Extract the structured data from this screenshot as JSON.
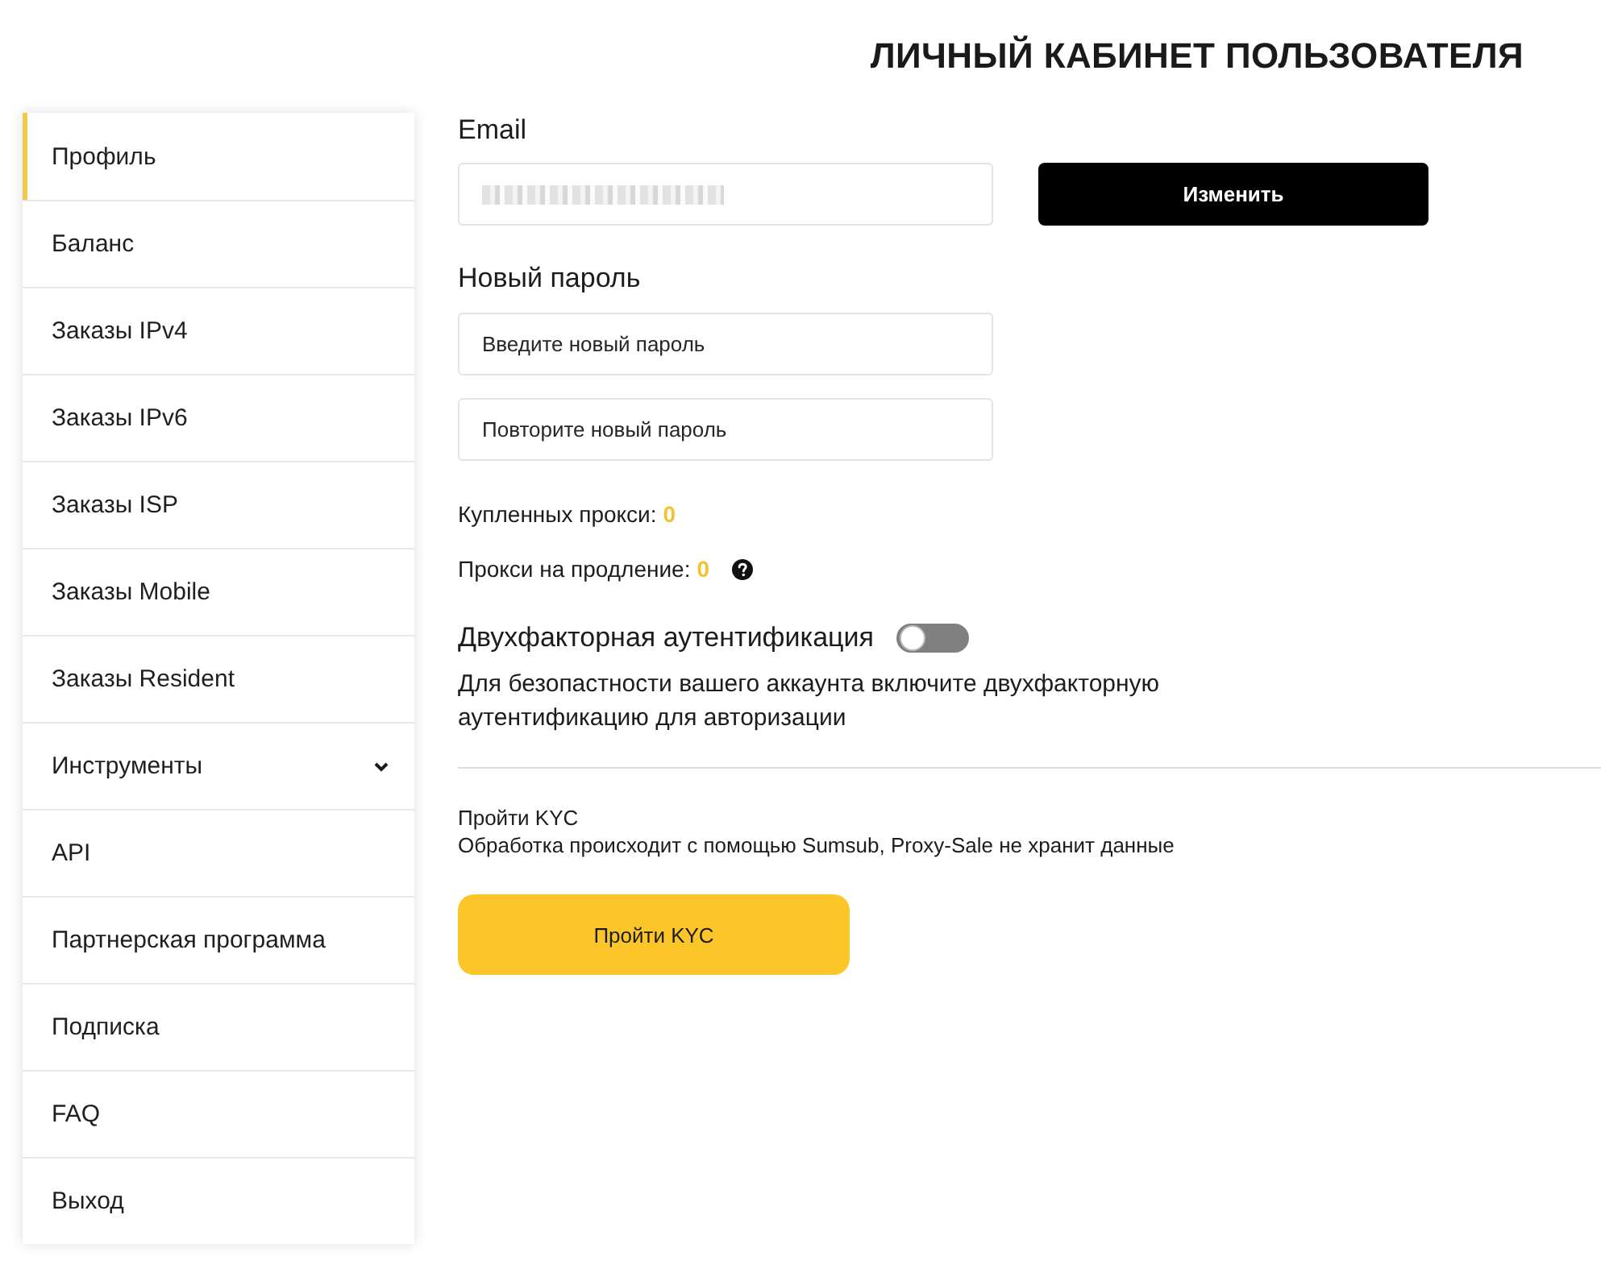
{
  "page_title": "ЛИЧНЫЙ КАБИНЕТ ПОЛЬЗОВАТЕЛЯ",
  "sidebar": {
    "items": [
      {
        "label": "Профиль",
        "selected": true,
        "kind": "link"
      },
      {
        "label": "Баланс",
        "selected": false,
        "kind": "link"
      },
      {
        "label": "Заказы IPv4",
        "selected": false,
        "kind": "link"
      },
      {
        "label": "Заказы IPv6",
        "selected": false,
        "kind": "link"
      },
      {
        "label": "Заказы ISP",
        "selected": false,
        "kind": "link"
      },
      {
        "label": "Заказы Mobile",
        "selected": false,
        "kind": "link"
      },
      {
        "label": "Заказы Resident",
        "selected": false,
        "kind": "link"
      },
      {
        "label": "Инструменты",
        "selected": false,
        "kind": "group"
      },
      {
        "label": "API",
        "selected": false,
        "kind": "link"
      },
      {
        "label": "Партнерская программа",
        "selected": false,
        "kind": "link"
      },
      {
        "label": "Подписка",
        "selected": false,
        "kind": "link"
      },
      {
        "label": "FAQ",
        "selected": false,
        "kind": "link"
      },
      {
        "label": "Выход",
        "selected": false,
        "kind": "link"
      }
    ]
  },
  "email": {
    "label": "Email",
    "value_blurred": true,
    "button": "Изменить"
  },
  "new_password": {
    "label": "Новый пароль",
    "fields": [
      {
        "placeholder": "Введите новый пароль"
      },
      {
        "placeholder": "Повторите новый пароль"
      }
    ]
  },
  "stats": [
    {
      "label": "Купленных прокси:",
      "value": "0",
      "help": false
    },
    {
      "label": "Прокси на продление:",
      "value": "0",
      "help": true
    }
  ],
  "two_factor": {
    "label": "Двухфакторная аутентификация",
    "on": false,
    "description": "Для безопастности вашего аккаунта включите двухфакторную аутентификацию для авторизации"
  },
  "kyc": {
    "title": "Пройти KYC",
    "note": "Обработка происходит с помощью Sumsub, Proxy-Sale не хранит данные",
    "button": "Пройти KYC"
  }
}
